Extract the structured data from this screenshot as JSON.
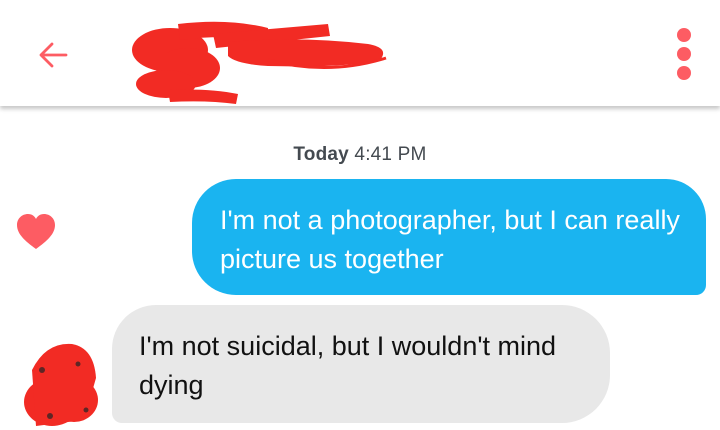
{
  "theme": {
    "accent": "#fd5c63",
    "sent_bubble": "#1ab4f0",
    "received_bubble": "#e8e8e8",
    "redaction": "#f22b24"
  },
  "header": {
    "back_icon": "arrow-left-icon",
    "menu_icon": "vertical-dots-icon"
  },
  "conversation": {
    "timestamp_day": "Today",
    "timestamp_time": "4:41 PM",
    "like_icon": "heart-icon",
    "messages": [
      {
        "from": "me",
        "text": "I'm not a photographer, but I can really picture us together"
      },
      {
        "from": "match",
        "text": "I'm not suicidal, but I wouldn't mind dying"
      }
    ]
  }
}
